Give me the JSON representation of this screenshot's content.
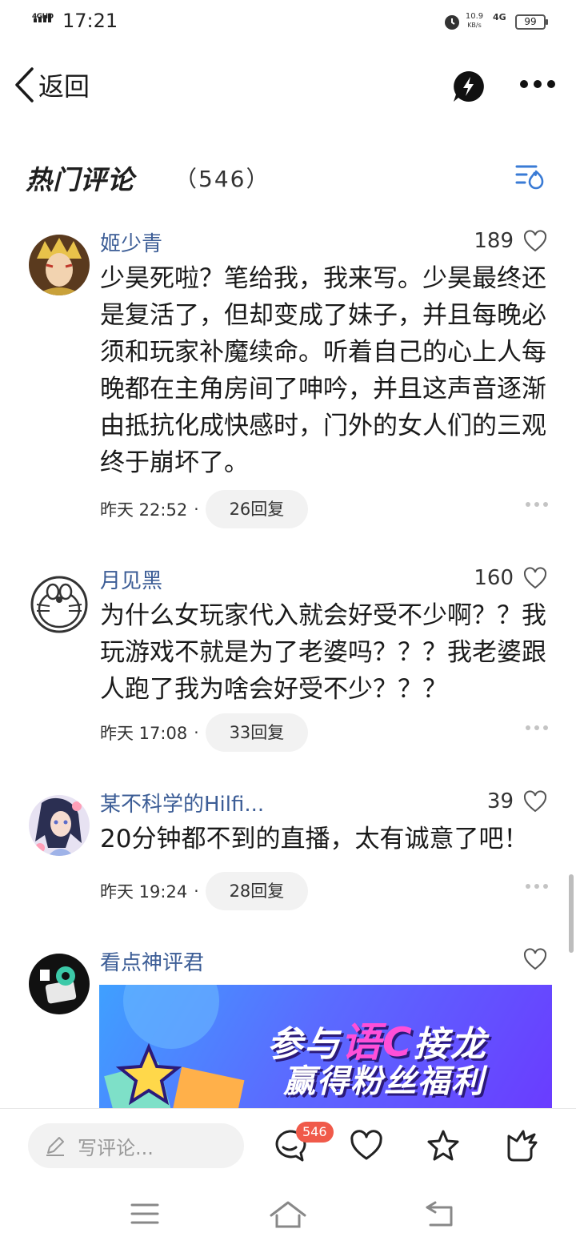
{
  "status_bar": {
    "network_label": "4GHD",
    "time": "17:21",
    "speed_value": "10.9",
    "speed_unit": "KB/s",
    "cell_type": "4G",
    "battery": "99"
  },
  "nav": {
    "back_label": "返回"
  },
  "section": {
    "title": "热门评论",
    "count": "（546）"
  },
  "comments": [
    {
      "username": "姬少青",
      "likes": "189",
      "text": "少昊死啦？笔给我，我来写。少昊最终还是复活了，但却变成了妹子，并且每晚必须和玩家补魔续命。听着自己的心上人每晚都在主角房间了呻吟，并且这声音逐渐由抵抗化成快感时，门外的女人们的三观终于崩坏了。",
      "time": "昨天 22:52",
      "replies": "26回复"
    },
    {
      "username": "月见黑",
      "likes": "160",
      "text": "为什么女玩家代入就会好受不少啊？？我玩游戏不就是为了老婆吗？？？我老婆跟人跑了我为啥会好受不少？？？",
      "time": "昨天 17:08",
      "replies": "33回复"
    },
    {
      "username": "某不科学的Hilfi...",
      "likes": "39",
      "text": "20分钟都不到的直播，太有诚意了吧！",
      "time": "昨天 19:24",
      "replies": "28回复"
    },
    {
      "username": "看点神评君",
      "likes": ""
    }
  ],
  "banner": {
    "line1_pre": "参与",
    "line1_char": "语C",
    "line1_post": "接龙",
    "line2": "赢得粉丝福利"
  },
  "bottom_bar": {
    "write_placeholder": "写评论...",
    "comment_badge": "546"
  },
  "colors": {
    "username": "#3c5d96",
    "badge": "#f05a4a",
    "icon_blue": "#3a7bd5"
  },
  "icons": [
    "back-chevron-icon",
    "flash-icon",
    "more-icon",
    "sort-icon",
    "heart-icon",
    "pencil-icon",
    "comment-icon",
    "star-icon",
    "share-icon",
    "menu-icon",
    "home-icon",
    "return-icon"
  ]
}
